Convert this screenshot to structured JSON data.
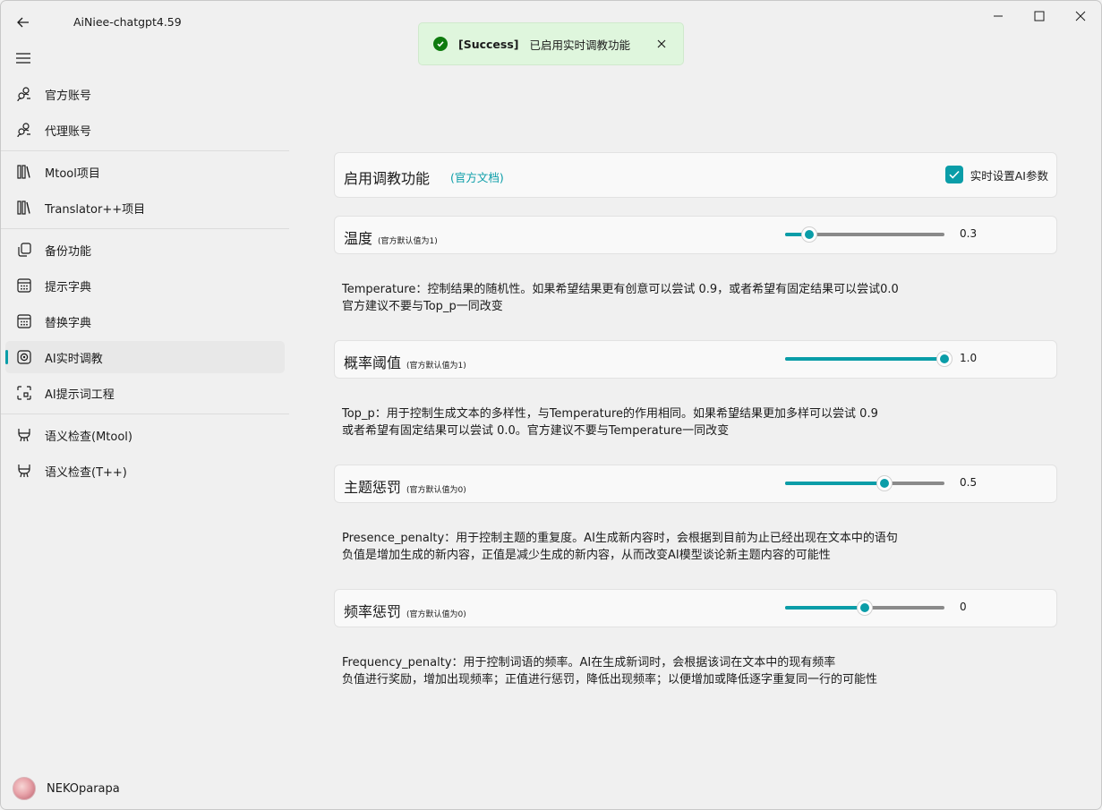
{
  "window": {
    "title": "AiNiee-chatgpt4.59"
  },
  "toast": {
    "tag": "[Success]",
    "message": "已启用实时调教功能"
  },
  "sidebar": {
    "items": [
      {
        "label": "官方账号",
        "icon": "account-icon"
      },
      {
        "label": "代理账号",
        "icon": "account-icon"
      },
      {
        "label": "Mtool项目",
        "icon": "library-icon"
      },
      {
        "label": "Translator++项目",
        "icon": "library-icon"
      },
      {
        "label": "备份功能",
        "icon": "copy-icon"
      },
      {
        "label": "提示字典",
        "icon": "calendar-icon"
      },
      {
        "label": "替换字典",
        "icon": "calendar-icon"
      },
      {
        "label": "AI实时调教",
        "icon": "target-icon",
        "active": true
      },
      {
        "label": "AI提示词工程",
        "icon": "scan-icon"
      },
      {
        "label": "语义检查(Mtool)",
        "icon": "broom-icon"
      },
      {
        "label": "语义检查(T++)",
        "icon": "broom-icon"
      }
    ],
    "user": "NEKOparapa"
  },
  "enable_card": {
    "title": "启用调教功能",
    "doc_link": "(官方文档)",
    "checkbox_label": "实时设置AI参数",
    "checked": true
  },
  "params": [
    {
      "title": "温度",
      "sub": "(官方默认值为1)",
      "value_text": "0.3",
      "fraction": 0.15,
      "desc": [
        "Temperature：控制结果的随机性。如果希望结果更有创意可以尝试 0.9，或者希望有固定结果可以尝试0.0",
        "官方建议不要与Top_p一同改变"
      ]
    },
    {
      "title": "概率阈值",
      "sub": "(官方默认值为1)",
      "value_text": "1.0",
      "fraction": 1.0,
      "desc": [
        "Top_p：用于控制生成文本的多样性，与Temperature的作用相同。如果希望结果更加多样可以尝试 0.9",
        "或者希望有固定结果可以尝试 0.0。官方建议不要与Temperature一同改变"
      ]
    },
    {
      "title": "主题惩罚",
      "sub": "(官方默认值为0)",
      "value_text": "0.5",
      "fraction": 0.625,
      "desc": [
        "Presence_penalty：用于控制主题的重复度。AI生成新内容时，会根据到目前为止已经出现在文本中的语句",
        "负值是增加生成的新内容，正值是减少生成的新内容，从而改变AI模型谈论新主题内容的可能性"
      ]
    },
    {
      "title": "频率惩罚",
      "sub": "(官方默认值为0)",
      "value_text": "0",
      "fraction": 0.5,
      "desc": [
        "Frequency_penalty：用于控制词语的频率。AI在生成新词时，会根据该词在文本中的现有频率",
        "负值进行奖励，增加出现频率；正值进行惩罚，降低出现频率；以便增加或降低逐字重复同一行的可能性"
      ]
    }
  ],
  "colors": {
    "accent": "#0a9da8",
    "success_bg": "#dff6dd",
    "success_icon": "#0f7b0f"
  }
}
